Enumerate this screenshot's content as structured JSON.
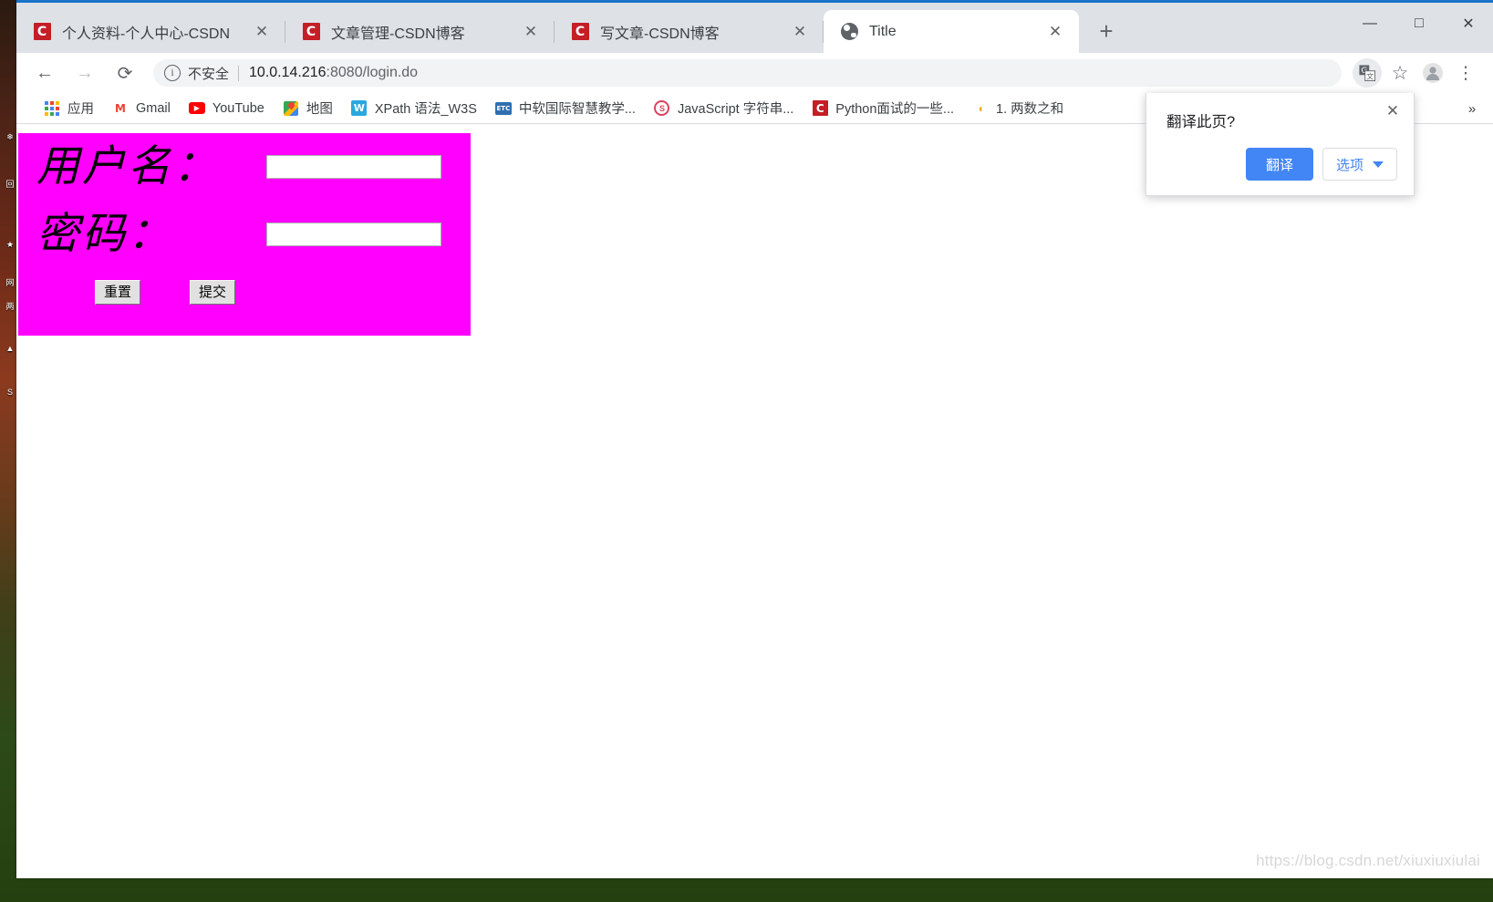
{
  "window": {
    "controls": [
      {
        "name": "minimize",
        "glyph": "—"
      },
      {
        "name": "maximize",
        "glyph": "□"
      },
      {
        "name": "close",
        "glyph": "✕"
      }
    ]
  },
  "tabs": [
    {
      "title": "个人资料-个人中心-CSDN",
      "favicon": "csdn-icon",
      "active": false,
      "close_glyph": "✕"
    },
    {
      "title": "文章管理-CSDN博客",
      "favicon": "csdn-icon",
      "active": false,
      "close_glyph": "✕"
    },
    {
      "title": "写文章-CSDN博客",
      "favicon": "csdn-icon",
      "active": false,
      "close_glyph": "✕"
    },
    {
      "title": "Title",
      "favicon": "globe-icon",
      "active": true,
      "close_glyph": "✕"
    }
  ],
  "new_tab_glyph": "+",
  "toolbar": {
    "back_glyph": "←",
    "forward_glyph": "→",
    "reload_glyph": "⟳",
    "info_glyph": "i",
    "security_text": "不安全",
    "url_host": "10.0.14.216",
    "url_rest": ":8080/login.do",
    "star_glyph": "☆",
    "menu_glyph": "⋮"
  },
  "bookmarks": {
    "items": [
      {
        "label": "应用",
        "icon": "apps-grid-icon"
      },
      {
        "label": "Gmail",
        "icon": "gmail-icon"
      },
      {
        "label": "YouTube",
        "icon": "youtube-icon"
      },
      {
        "label": "地图",
        "icon": "maps-icon"
      },
      {
        "label": "XPath 语法_W3S",
        "icon": "w3schools-icon"
      },
      {
        "label": "中软国际智慧教学...",
        "icon": "etc-icon"
      },
      {
        "label": "JavaScript 字符串...",
        "icon": "javascript-icon"
      },
      {
        "label": "Python面试的一些...",
        "icon": "csdn-icon"
      },
      {
        "label": "1. 两数之和",
        "icon": "leetcode-icon"
      }
    ],
    "overflow_glyph": "»"
  },
  "translate_bubble": {
    "title": "翻译此页?",
    "translate_label": "翻译",
    "options_label": "选项",
    "close_glyph": "✕"
  },
  "page": {
    "panel_color": "#ff00ff",
    "username_label": "用户名：",
    "password_label": "密码：",
    "username_value": "",
    "password_value": "",
    "username_placeholder": "",
    "password_placeholder": "",
    "reset_label": "重置",
    "submit_label": "提交"
  },
  "watermark": "https://blog.csdn.net/xiuxiuxiulai",
  "desktop_icons": [
    {
      "glyph": "❄"
    },
    {
      "glyph": "回"
    },
    {
      "glyph": "★"
    },
    {
      "glyph": "网"
    },
    {
      "glyph": "两"
    },
    {
      "glyph": "▲"
    },
    {
      "glyph": "S"
    }
  ]
}
